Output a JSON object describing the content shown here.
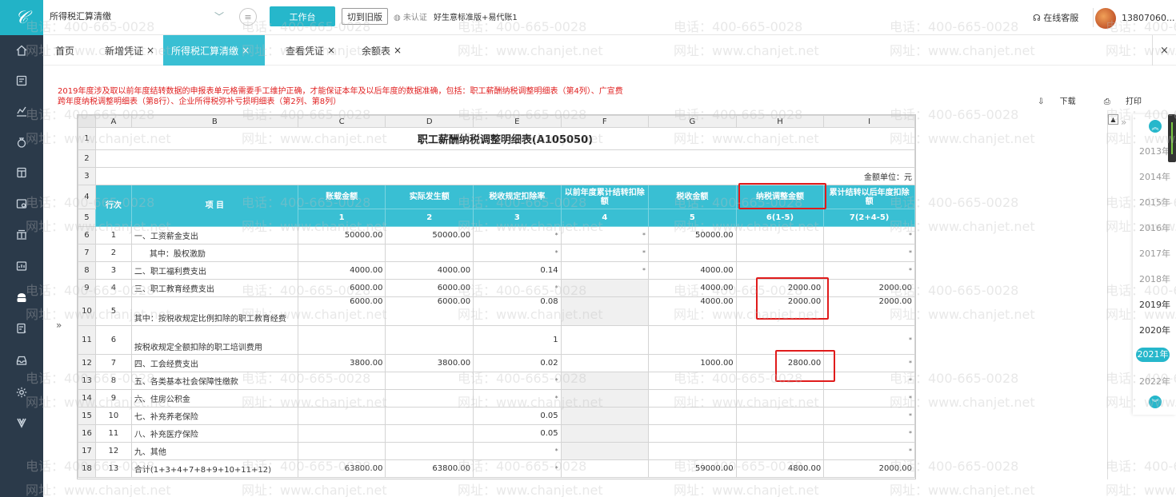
{
  "app": {
    "module_name": "所得税汇算清缴",
    "workbench_label": "工作台",
    "old_version_label": "切到旧版",
    "cert_label": "未认证",
    "account_label": "好生意标准版+易代账1",
    "service_label": "在线客服",
    "user_phone": "13807060..."
  },
  "tabs": [
    {
      "label": "首页",
      "closable": false,
      "active": false
    },
    {
      "label": "新增凭证",
      "closable": true,
      "active": false
    },
    {
      "label": "所得税汇算清缴",
      "closable": true,
      "active": true
    },
    {
      "label": "查看凭证",
      "closable": true,
      "active": false
    },
    {
      "label": "余额表",
      "closable": true,
      "active": false
    }
  ],
  "close_symbol": "×",
  "notice": "2019年度涉及取以前年度结转数据的申报表单元格需要手工维护正确，才能保证本年及以后年度的数据准确，包括：职工薪酬纳税调整明细表（第4列）、广宣费跨年度纳税调整明细表（第8行）、企业所得税弥补亏损明细表（第2列、第8列）",
  "actions": {
    "download": "下载",
    "print": "打印"
  },
  "sheet": {
    "col_letters": [
      "A",
      "B",
      "C",
      "D",
      "E",
      "F",
      "G",
      "H",
      "I"
    ],
    "title": "职工薪酬纳税调整明细表(A105050)",
    "unit": "金额单位：元",
    "headers": {
      "row_no": "行次",
      "item": "项 目",
      "c": "账载金额",
      "d": "实际发生额",
      "e": "税收规定扣除率",
      "f": "以前年度累计结转扣除额",
      "g": "税收金额",
      "h": "纳税调整金额",
      "i": "累计结转以后年度扣除额"
    },
    "col_numbers": [
      "1",
      "2",
      "3",
      "4",
      "5",
      "6(1-5)",
      "7(2+4-5)"
    ],
    "rows": [
      {
        "r": "6",
        "no": "1",
        "item": "一、工资薪金支出",
        "c": "50000.00",
        "d": "50000.00",
        "e": "",
        "f": "",
        "g": "50000.00",
        "h": "",
        "i": ""
      },
      {
        "r": "7",
        "no": "2",
        "item": "其中：股权激励",
        "c": "",
        "d": "",
        "e": "",
        "f": "",
        "g": "",
        "h": "",
        "i": ""
      },
      {
        "r": "8",
        "no": "3",
        "item": "二、职工福利费支出",
        "c": "4000.00",
        "d": "4000.00",
        "e": "0.14",
        "f": "",
        "g": "4000.00",
        "h": "",
        "i": ""
      },
      {
        "r": "9",
        "no": "4",
        "item": "三、职工教育经费支出",
        "c": "6000.00",
        "d": "6000.00",
        "e": "",
        "f": "",
        "g": "4000.00",
        "h": "2000.00",
        "i": "2000.00"
      },
      {
        "r": "10",
        "no": "5",
        "item": "其中：按税收规定比例扣除的职工教育经费",
        "c": "6000.00",
        "d": "6000.00",
        "e": "0.08",
        "f": "",
        "g": "4000.00",
        "h": "2000.00",
        "i": "2000.00"
      },
      {
        "r": "11",
        "no": "6",
        "item": "按税收规定全额扣除的职工培训费用",
        "c": "",
        "d": "",
        "e": "1",
        "f": "",
        "g": "",
        "h": "",
        "i": ""
      },
      {
        "r": "12",
        "no": "7",
        "item": "四、工会经费支出",
        "c": "3800.00",
        "d": "3800.00",
        "e": "0.02",
        "f": "",
        "g": "1000.00",
        "h": "2800.00",
        "i": ""
      },
      {
        "r": "13",
        "no": "8",
        "item": "五、各类基本社会保障性缴款",
        "c": "",
        "d": "",
        "e": "",
        "f": "",
        "g": "",
        "h": "",
        "i": ""
      },
      {
        "r": "14",
        "no": "9",
        "item": "六、住房公积金",
        "c": "",
        "d": "",
        "e": "",
        "f": "",
        "g": "",
        "h": "",
        "i": ""
      },
      {
        "r": "15",
        "no": "10",
        "item": "七、补充养老保险",
        "c": "",
        "d": "",
        "e": "0.05",
        "f": "",
        "g": "",
        "h": "",
        "i": ""
      },
      {
        "r": "16",
        "no": "11",
        "item": "八、补充医疗保险",
        "c": "",
        "d": "",
        "e": "0.05",
        "f": "",
        "g": "",
        "h": "",
        "i": ""
      },
      {
        "r": "17",
        "no": "12",
        "item": "九、其他",
        "c": "",
        "d": "",
        "e": "",
        "f": "",
        "g": "",
        "h": "",
        "i": ""
      },
      {
        "r": "18",
        "no": "13",
        "item": "合计(1+3+4+7+8+9+10+11+12)",
        "c": "63800.00",
        "d": "63800.00",
        "e": "",
        "f": "",
        "g": "59000.00",
        "h": "4800.00",
        "i": "2000.00"
      }
    ]
  },
  "years": [
    "2013年",
    "2014年",
    "2015年",
    "2016年",
    "2017年",
    "2018年",
    "2019年",
    "2020年",
    "2021年",
    "2022年"
  ],
  "active_year": "2021年",
  "watermark": {
    "phone": "电话：400-665-0028",
    "site": "网址：www.chanjet.net"
  },
  "colors": {
    "accent": "#26b7cb",
    "sidebar": "#2b3a4a",
    "notice": "#e02020",
    "highlight_box": "#e01b1b"
  }
}
